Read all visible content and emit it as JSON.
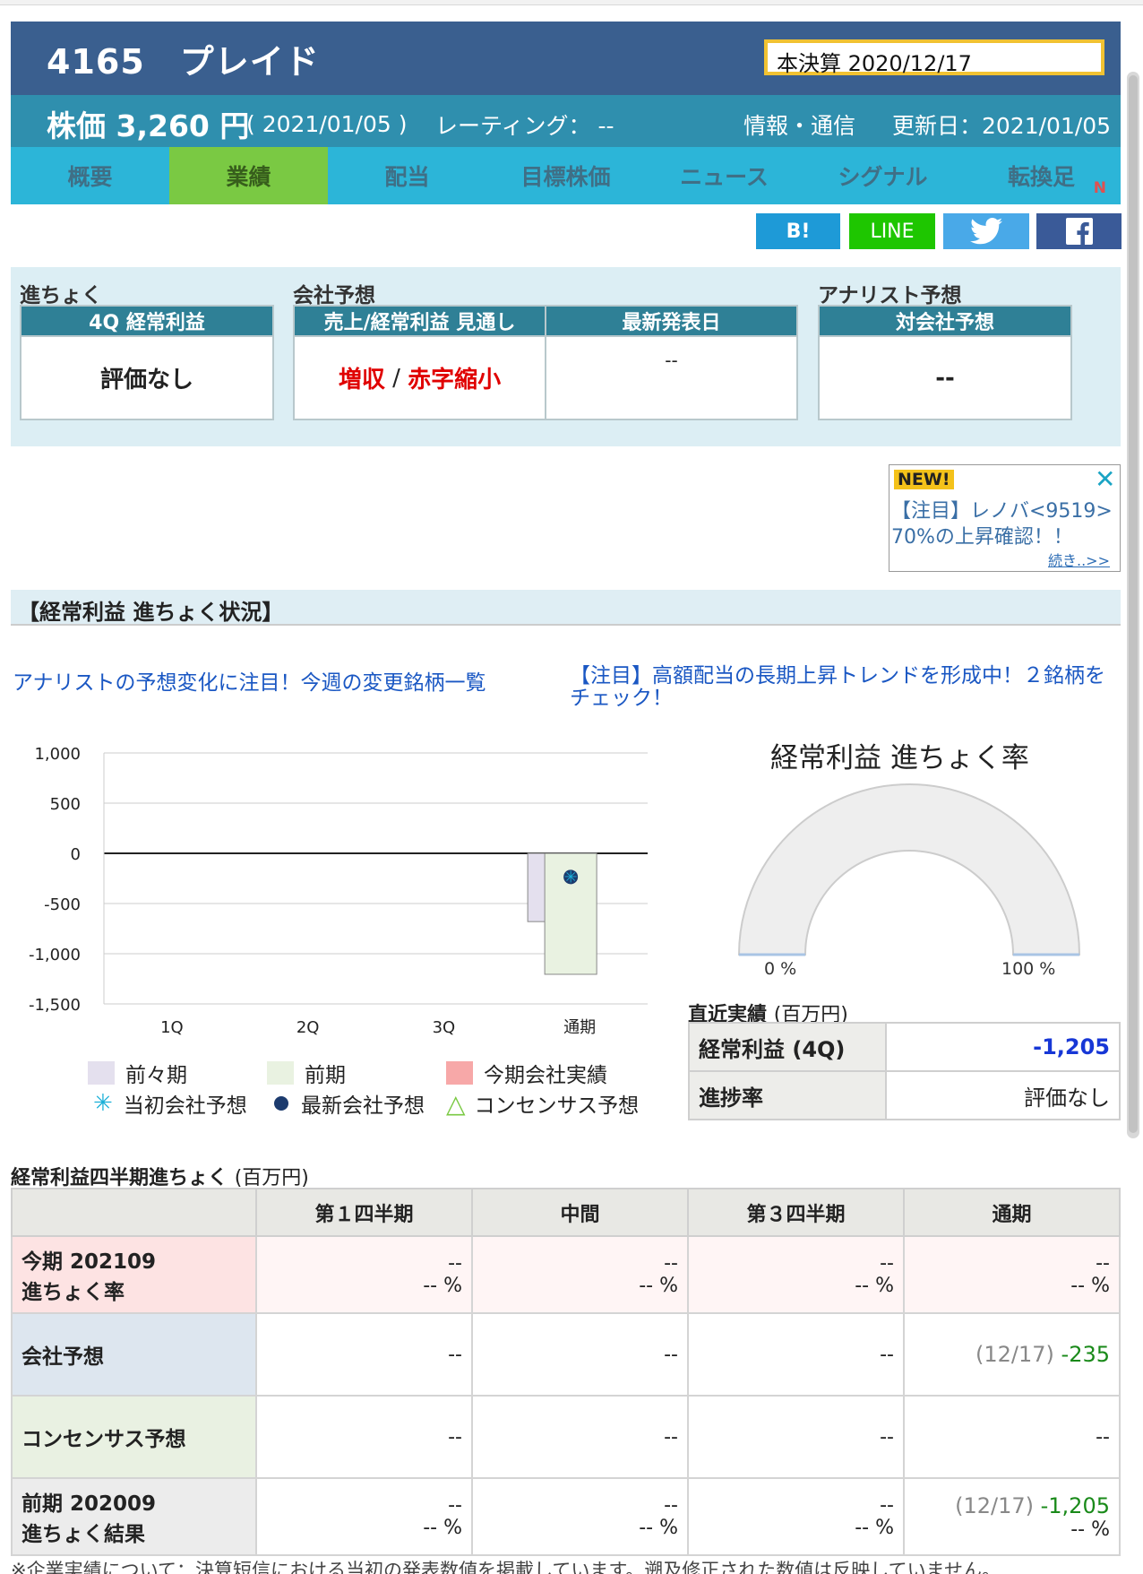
{
  "header": {
    "code_name": "4165　プレイド",
    "fiscal": "本決算 2020/12/17",
    "price": "株価 3,260 円",
    "price_date": "( 2021/01/05 )",
    "rating": "レーティング： --",
    "sector": "情報・通信",
    "updated": "更新日：2021/01/05"
  },
  "tabs": [
    {
      "label": "概要"
    },
    {
      "label": "業績"
    },
    {
      "label": "配当"
    },
    {
      "label": "目標株価"
    },
    {
      "label": "ニュース"
    },
    {
      "label": "シグナル"
    },
    {
      "label": "転換足",
      "sup": "N"
    }
  ],
  "social": {
    "hatena": "B!",
    "line": "LINE"
  },
  "progress": {
    "label_progress": "進ちょく",
    "label_company": "会社予想",
    "label_analyst": "アナリスト予想",
    "card1_head": "4Q 経常利益",
    "card1_value": "評価なし",
    "card2_head": "売上/経常利益 見通し",
    "card2_value_a": "増収",
    "card2_sep": " / ",
    "card2_value_b": "赤字縮小",
    "card3_head": "最新発表日",
    "card3_value": "--",
    "card4_head": "対会社予想",
    "card4_value": "--"
  },
  "ad": {
    "new": "NEW!",
    "close": "✕",
    "line1": "【注目】レノバ<9519>",
    "line2": "70%の上昇確認！！",
    "more": "続き..>>"
  },
  "section_title": "【経常利益 進ちょく状況】",
  "links": {
    "link1": "アナリストの予想変化に注目！今週の変更銘柄一覧",
    "link2": "【注目】高額配当の長期上昇トレンドを形成中！２銘柄をチェック！"
  },
  "chart_data": {
    "type": "bar",
    "categories": [
      "1Q",
      "2Q",
      "3Q",
      "通期"
    ],
    "ylim": [
      -1500,
      1000
    ],
    "yticks": [
      "1,000",
      "500",
      "0",
      "-500",
      "-1,000",
      "-1,500"
    ],
    "series": [
      {
        "name": "前々期",
        "values": [
          null,
          null,
          null,
          -680
        ],
        "color": "#e4e0ee"
      },
      {
        "name": "前期",
        "values": [
          null,
          null,
          null,
          -1205
        ],
        "color": "#e9f2e1"
      },
      {
        "name": "今期会社実績",
        "values": [
          null,
          null,
          null,
          null
        ],
        "color": "#f7a8a8"
      }
    ],
    "markers": [
      {
        "name": "当初会社予想",
        "values": [
          null,
          null,
          null,
          -235
        ],
        "color": "#1ab0d8"
      },
      {
        "name": "最新会社予想",
        "values": [
          null,
          null,
          null,
          -235
        ],
        "color": "#1c3b6e"
      },
      {
        "name": "コンセンサス予想",
        "values": [
          null,
          null,
          null,
          null
        ],
        "color": "#7ac943"
      }
    ],
    "grid": true
  },
  "gauge": {
    "title": "経常利益 進ちょく率",
    "label_min": "0 %",
    "label_max": "100 %",
    "value_percent": 0
  },
  "recent": {
    "title": "直近実績",
    "unit": "(百万円)",
    "rows": [
      {
        "key": "経常利益 (4Q)",
        "value": "-1,205"
      },
      {
        "key": "進捗率",
        "value": "評価なし"
      }
    ]
  },
  "quarterly": {
    "title": "経常利益四半期進ちょく",
    "unit": "(百万円)",
    "columns": [
      "第１四半期",
      "中間",
      "第３四半期",
      "通期"
    ],
    "row_current": {
      "label1": "今期 202109",
      "label2": "進ちょく率",
      "cells": [
        "--",
        "--",
        "--",
        "--"
      ],
      "pcts": [
        "-- %",
        "-- %",
        "-- %",
        "-- %"
      ]
    },
    "row_company": {
      "label": "会社予想",
      "cells": [
        "--",
        "--",
        "--"
      ],
      "last_date": "(12/17)",
      "last_value": "-235"
    },
    "row_consensus": {
      "label": "コンセンサス予想",
      "cells": [
        "--",
        "--",
        "--",
        "--"
      ]
    },
    "row_prev": {
      "label1": "前期 202009",
      "label2": "進ちょく結果",
      "cells": [
        "--",
        "--",
        "--"
      ],
      "last_date": "(12/17)",
      "last_value": "-1,205",
      "pcts": [
        "-- %",
        "-- %",
        "-- %",
        "-- %"
      ]
    }
  },
  "footnote": "※企業実績について：決算短信における当初の発表数値を掲載しています。遡及修正された数値は反映していません。"
}
